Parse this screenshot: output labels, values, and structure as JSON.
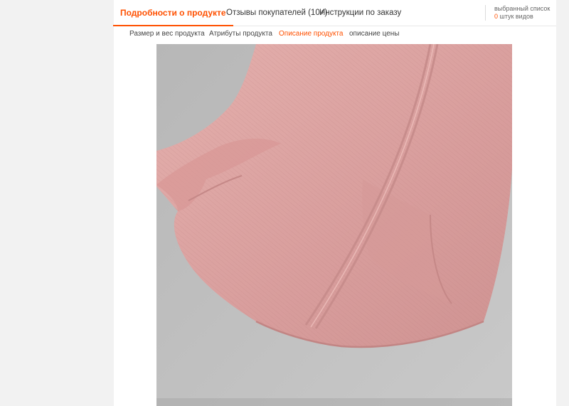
{
  "main_tabs": [
    {
      "label": "Подробности о продукте",
      "active": true
    },
    {
      "label": "Отзывы покупателей (10+)",
      "active": false
    },
    {
      "label": "Инструкции по заказу",
      "active": false
    }
  ],
  "wishlist": {
    "title": "выбранный список",
    "count": "0",
    "count_suffix": " штук видов"
  },
  "sub_tabs": [
    {
      "label": "Размер и вес продукта",
      "active": false
    },
    {
      "label": "Атрибуты продукта",
      "active": false
    },
    {
      "label": "Описание продукта",
      "active": true
    },
    {
      "label": "описание цены",
      "active": false
    }
  ],
  "colors": {
    "accent": "#ff5000",
    "fabric": "#dba3a3",
    "backdrop": "#bdbdbd"
  }
}
